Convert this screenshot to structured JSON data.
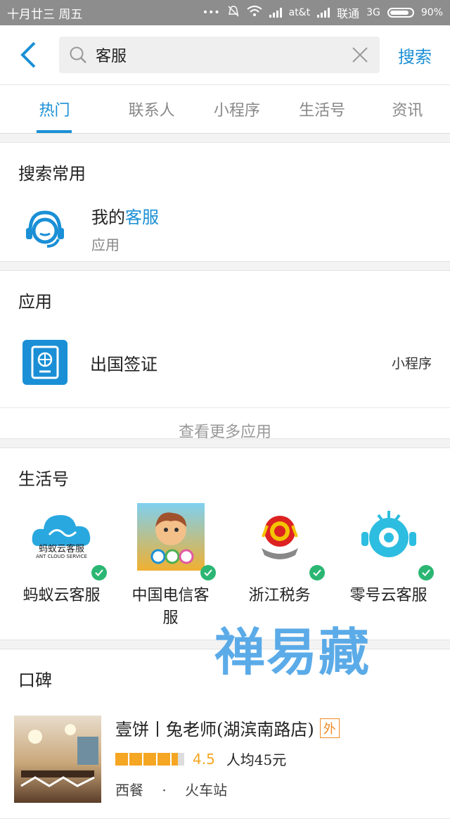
{
  "status_bar": {
    "date": "十月廿三 周五",
    "carrier1": "at&t",
    "carrier2": "联通",
    "network": "3G",
    "battery": "90%"
  },
  "search": {
    "query": "客服",
    "button_label": "搜索"
  },
  "tabs": [
    {
      "label": "热门",
      "active": true
    },
    {
      "label": "联系人"
    },
    {
      "label": "小程序"
    },
    {
      "label": "生活号"
    },
    {
      "label": "资讯"
    }
  ],
  "frequent": {
    "title": "搜索常用",
    "item": {
      "name_prefix": "我的",
      "name_highlight": "客服",
      "sub": "应用"
    }
  },
  "apps": {
    "title": "应用",
    "item": {
      "name": "出国签证",
      "tag": "小程序"
    },
    "more_label": "查看更多应用"
  },
  "life": {
    "title": "生活号",
    "items": [
      {
        "name": "蚂蚁云客服",
        "logo_text": "蚂蚁云客服",
        "logo_sub": "ANT CLOUD SERVICE"
      },
      {
        "name": "中国电信客服"
      },
      {
        "name": "浙江税务"
      },
      {
        "name": "零号云客服"
      }
    ]
  },
  "reviews": {
    "title": "口碑",
    "item": {
      "name": "壹饼丨兔老师(湖滨南路店)",
      "badge": "外",
      "rating": "4.5",
      "price": "人均45元",
      "category": "西餐",
      "location": "火车站"
    }
  },
  "watermark": "禅易藏"
}
